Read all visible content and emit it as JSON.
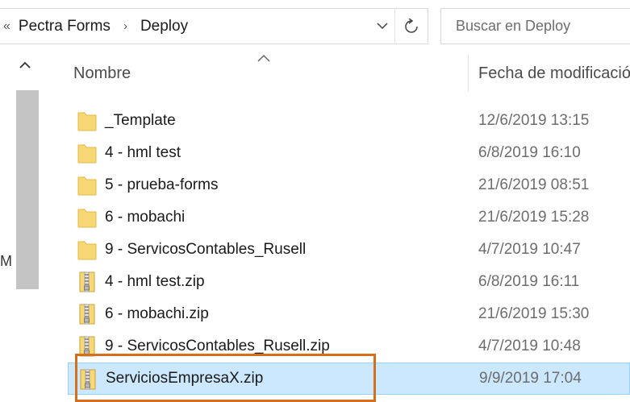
{
  "address_bar": {
    "overflow_glyph": "«",
    "breadcrumbs": [
      {
        "label": "Pectra Forms"
      },
      {
        "label": "Deploy"
      }
    ],
    "separator": "›"
  },
  "search": {
    "placeholder": "Buscar en Deploy"
  },
  "nav_pane": {
    "partial_letter": "M"
  },
  "columns": {
    "name": "Nombre",
    "date": "Fecha de modificación"
  },
  "files": [
    {
      "name": "_Template",
      "date": "12/6/2019 13:15",
      "type": "folder",
      "selected": false
    },
    {
      "name": "4 - hml test",
      "date": "6/8/2019 16:10",
      "type": "folder",
      "selected": false
    },
    {
      "name": "5 - prueba-forms",
      "date": "21/6/2019 08:51",
      "type": "folder",
      "selected": false
    },
    {
      "name": "6 - mobachi",
      "date": "21/6/2019 15:28",
      "type": "folder",
      "selected": false
    },
    {
      "name": "9 - ServicosContables_Rusell",
      "date": "4/7/2019 10:47",
      "type": "folder",
      "selected": false
    },
    {
      "name": "4 - hml test.zip",
      "date": "6/8/2019 16:11",
      "type": "zip",
      "selected": false
    },
    {
      "name": "6 - mobachi.zip",
      "date": "21/6/2019 15:30",
      "type": "zip",
      "selected": false
    },
    {
      "name": "9 - ServicosContables_Rusell.zip",
      "date": "4/7/2019 10:48",
      "type": "zip",
      "selected": false
    },
    {
      "name": "ServiciosEmpresaX.zip",
      "date": "9/9/2019 17:04",
      "type": "zip",
      "selected": true
    }
  ],
  "colors": {
    "selection_bg": "#cce8ff",
    "selection_border": "#99d1ff",
    "highlight_annotation": "#d46f1e",
    "folder_yellow": "#f8d775"
  }
}
